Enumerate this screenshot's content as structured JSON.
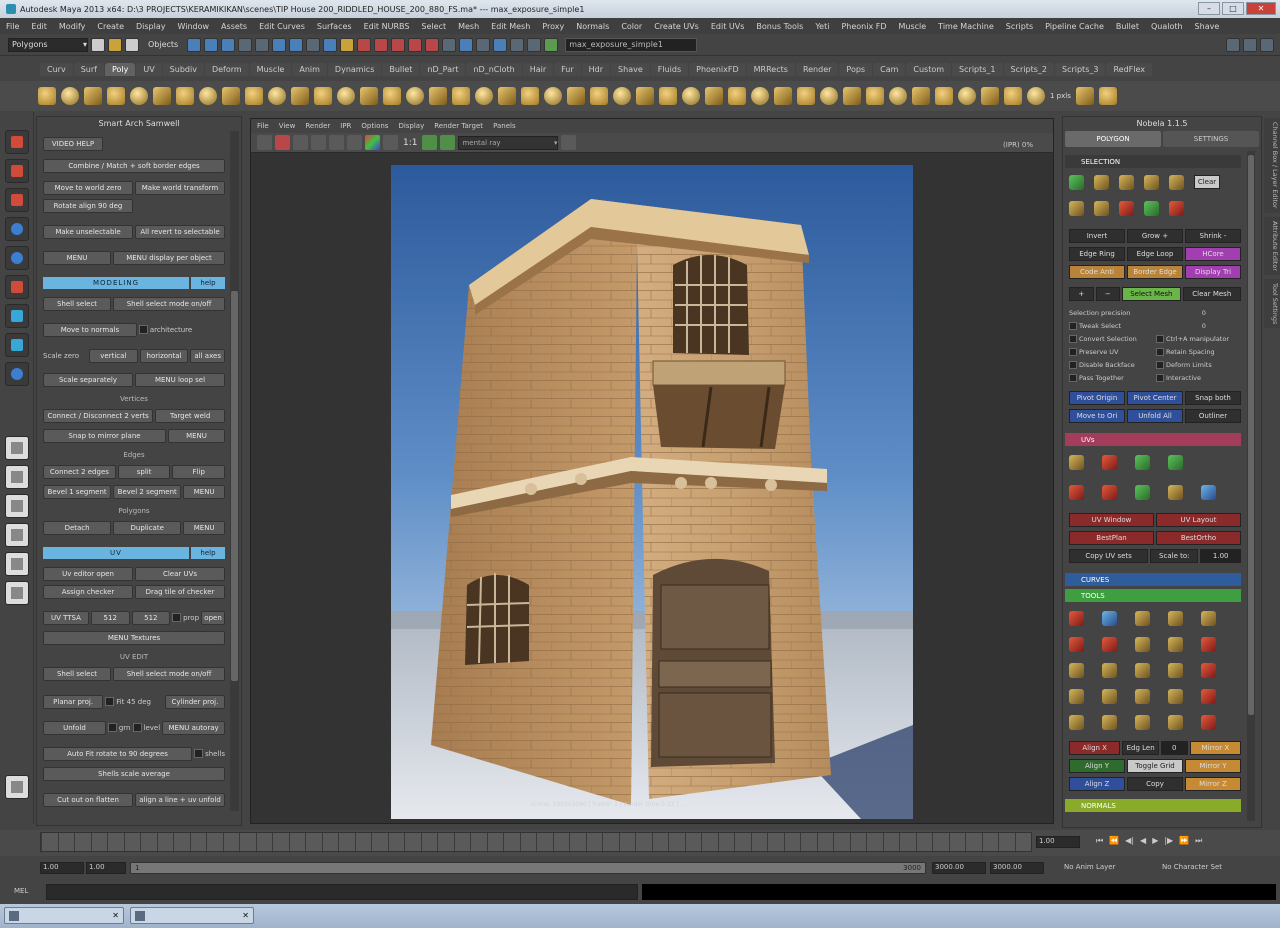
{
  "window": {
    "title": "Autodesk Maya 2013 x64: D:\\3 PROJECTS\\KERAMIKIKAN\\scenes\\TIP House 200_RIDDLED_HOUSE_200_880_FS.ma* --- max_exposure_simple1",
    "controls": {
      "minimize": "–",
      "maximize": "□",
      "close": "✕"
    }
  },
  "menubar": [
    "File",
    "Edit",
    "Modify",
    "Create",
    "Display",
    "Window",
    "Assets",
    "Edit Curves",
    "Surfaces",
    "Edit NURBS",
    "Select",
    "Mesh",
    "Edit Mesh",
    "Proxy",
    "Normals",
    "Color",
    "Create UVs",
    "Edit UVs",
    "Bonus Tools",
    "Yeti",
    "Pheonix FD",
    "Muscle",
    "Time Machine",
    "Scripts",
    "Pipeline Cache",
    "Bullet",
    "Qualoth",
    "Shave"
  ],
  "statusline": {
    "mode": "Polygons",
    "objects_label": "Objects",
    "input_value": "max_exposure_simple1"
  },
  "shelf_tabs": [
    "Curv",
    "Surf",
    "Poly",
    "UV",
    "Subdiv",
    "Deform",
    "Muscle",
    "Anim",
    "Dynamics",
    "Bullet",
    "nD_Part",
    "nD_nCloth",
    "Hair",
    "Fur",
    "Hdr",
    "Shave",
    "Fluids",
    "PhoenixFD",
    "MRRects",
    "Render",
    "Pops",
    "Cam",
    "Custom",
    "Scripts_1",
    "Scripts_2",
    "Scripts_3",
    "RedFlex"
  ],
  "shelf_active": "Poly",
  "shelf_extra": "1 pxls",
  "left_panel": {
    "title": "Smart Arch Samwell",
    "video_help": "VIDEO HELP",
    "combine": "Combine / Match + soft border edges",
    "move_world_zero": "Move to world zero",
    "make_world_transform": "Make world transform",
    "rotate_align": "Rotate align 90 deg",
    "make_unselectable": "Make unselectable",
    "all_revert": "All revert to selectable",
    "menu1": "MENU",
    "menu_display": "MENU display per object",
    "modeling_header": "MODELING",
    "help": "help",
    "shell_select": "Shell select",
    "shell_select_mode": "Shell select mode on/off",
    "move_to_normals": "Move to normals",
    "architecture": "architecture",
    "scale_zero": "Scale zero",
    "vertical": "vertical",
    "horizontal": "horizontal",
    "all_axes": "all axes",
    "scale_separately": "Scale separately",
    "menu_loop_sel": "MENU loop sel",
    "vertices_label": "Vertices",
    "connect_disconnect": "Connect / Disconnect 2 verts",
    "target_weld": "Target weld",
    "snap_mirror": "Snap to mirror plane",
    "menu2": "MENU",
    "edges_label": "Edges",
    "connect_2_edges": "Connect 2 edges",
    "split": "split",
    "flip": "Flip",
    "bevel_1": "Bevel 1 segment",
    "bevel_2": "Bevel 2 segment",
    "menu3": "MENU",
    "polygons_label": "Polygons",
    "detach": "Detach",
    "duplicate": "Duplicate",
    "menu4": "MENU",
    "uv_header": "UV",
    "uv_help": "help",
    "uv_editor": "Uv editor open",
    "clear_uvs": "Clear UVs",
    "assign_checker": "Assign checker",
    "drag_checker": "Drag tile of checker",
    "uv_prefix": "UV TTSA",
    "uv_val1": "512",
    "uv_val2": "512",
    "prop": "prop",
    "open": "open",
    "menu_textures": "MENU Textures",
    "uv_edit_label": "UV EDIT",
    "uv_shell_select": "Shell select",
    "uv_shell_mode": "Shell select mode on/off",
    "planar_proj": "Planar proj.",
    "fit_deg": "Fit 45 deg",
    "cylinder_proj": "Cylinder proj.",
    "unfold": "Unfold",
    "grn": "grn",
    "level": "level",
    "menu_autoray": "MENU autoray",
    "auto_fit": "Auto Fit rotate to 90 degrees",
    "shells": "shells",
    "shells_scale": "Shells scale average",
    "cut_out_flatten": "Cut out on flatten",
    "align_unfold": "align a line + uv unfold"
  },
  "viewport": {
    "menu": [
      "File",
      "View",
      "Render",
      "IPR",
      "Options",
      "Display",
      "Render Target",
      "Panels"
    ],
    "ratio": "1:1",
    "renderer": "mental ray",
    "right_label": "(IPR) 0% ",
    "caption": "scene: 1920x1080 | frame: 1 | render time 0:22 | ..."
  },
  "right_panel": {
    "title": "Nobela 1.1.5",
    "tab_polygon": "POLYGON",
    "tab_settings": "SETTINGS",
    "selection_hdr": "SELECTION",
    "clear": "Clear",
    "invert": "Invert",
    "grow": "Grow +",
    "shrink": "Shrink -",
    "edge_ring": "Edge Ring",
    "edge_loop": "Edge Loop",
    "hcore": "HCore",
    "code_anti": "Code Anti",
    "border_edge": "Border Edge",
    "display_tri": "Display Tri",
    "select_mesh": "Select Mesh",
    "clear_mesh": "Clear Mesh",
    "sel_precision": "Selection precision",
    "sel_precision_val": "0",
    "tweak_select": "Tweak Select",
    "tweak_val": "0",
    "convert_sel": "Convert Selection",
    "ctrl_manipulator": "Ctrl+A manipulator",
    "preserve_uv": "Preserve UV",
    "retain_spacing": "Retain Spacing",
    "disable_backface": "Disable Backface",
    "deform_limits": "Deform Limits",
    "pass_together": "Pass Together",
    "interactive": "Interactive",
    "pivot_origin": "Pivot Origin",
    "pivot_center": "Pivot Center",
    "snap_both": "Snap both",
    "move_to_ori": "Move to Ori",
    "unfold_all": "Unfold All",
    "outliner": "Outliner",
    "uvs_hdr": "UVs",
    "uv_window": "UV Window",
    "uv_layout": "UV Layout",
    "best_plan": "BestPlan",
    "best_ortho": "BestOrtho",
    "copy_uv_sets": "Copy UV sets",
    "scale_to": "Scale to:",
    "scale_to_val": "1.00",
    "curves_hdr": "CURVES",
    "tools_hdr": "TOOLS",
    "align_x": "Align X",
    "edg_len": "Edg Len",
    "edg_val": "0",
    "mirror_x": "Mirror X",
    "align_y": "Align Y",
    "toggle_grid": "Toggle Grid",
    "mirror_y": "Mirror Y",
    "align_z": "Align Z",
    "copy": "Copy",
    "mirror_z": "Mirror Z",
    "normals_hdr": "NORMALS",
    "side_tabs": [
      "Channel Box / Layer Editor",
      "Attribute Editor",
      "Tool Settings"
    ]
  },
  "timeline": {
    "current": "1.00",
    "playback": [
      "⏮",
      "⏪",
      "◀|",
      "◀",
      "▶",
      "|▶",
      "⏩",
      "⏭"
    ]
  },
  "range": {
    "start": "1.00",
    "start_inner": "1.00",
    "bar_left": "1",
    "bar_right": "3000",
    "end_inner": "3000.00",
    "end": "3000.00",
    "anim_layer": "No Anim Layer",
    "char_set": "No Character Set"
  },
  "command": {
    "label": "MEL"
  },
  "taskbar": [
    "",
    ""
  ]
}
